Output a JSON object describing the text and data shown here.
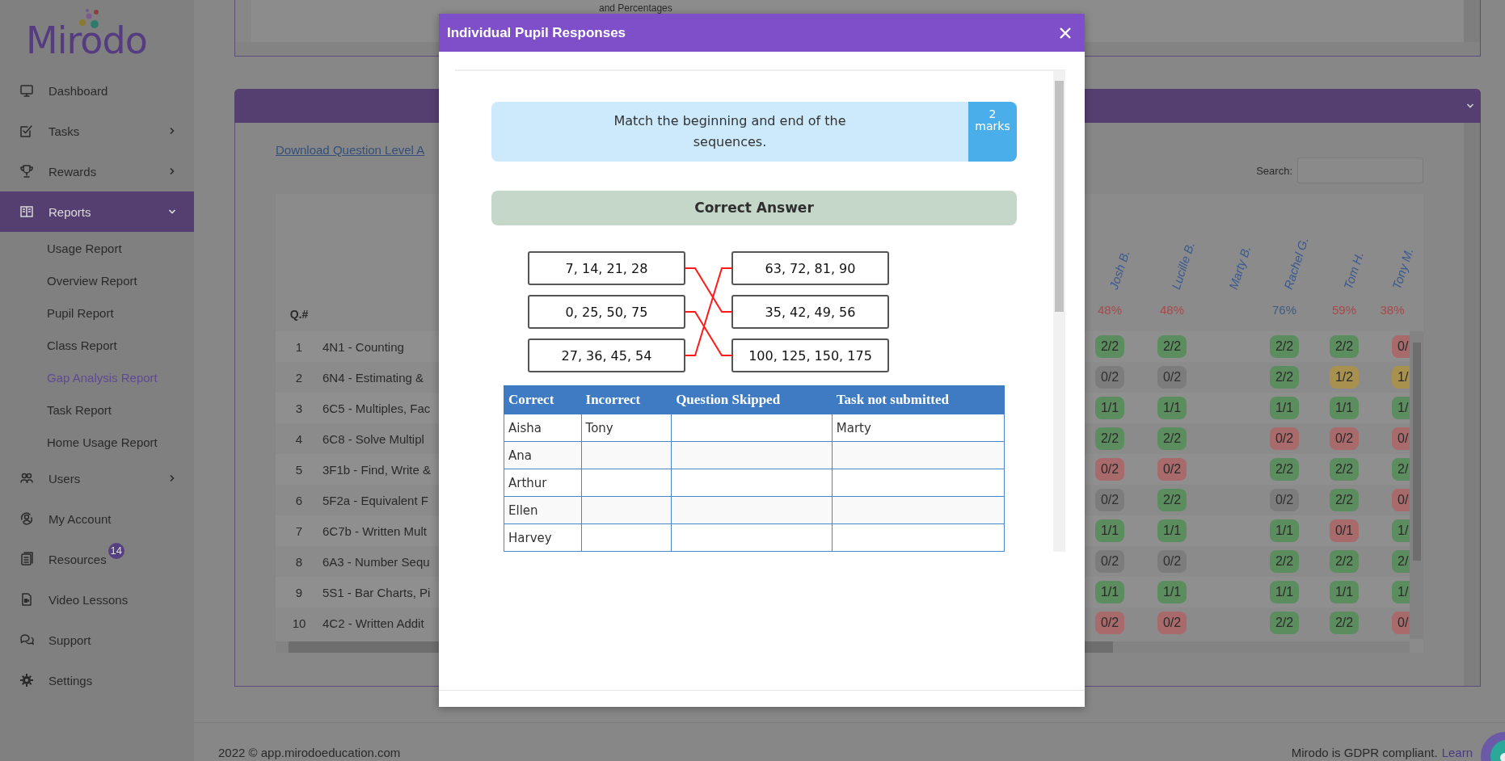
{
  "sidebar": {
    "logo": "Mirodo",
    "items": [
      {
        "label": "Dashboard",
        "selected": false
      },
      {
        "label": "Tasks",
        "selected": false,
        "expanded": false
      },
      {
        "label": "Rewards",
        "selected": false,
        "expanded": false
      },
      {
        "label": "Reports",
        "selected": true,
        "expanded": true,
        "children": [
          {
            "label": "Usage Report",
            "selected": false
          },
          {
            "label": "Overview Report",
            "selected": false
          },
          {
            "label": "Pupil Report",
            "selected": false
          },
          {
            "label": "Class Report",
            "selected": false
          },
          {
            "label": "Gap Analysis Report",
            "selected": true
          },
          {
            "label": "Task Report",
            "selected": false
          },
          {
            "label": "Home Usage Report",
            "selected": false
          }
        ]
      },
      {
        "label": "Users",
        "selected": false,
        "expanded": false
      },
      {
        "label": "My Account",
        "selected": false
      },
      {
        "label": "Resources",
        "selected": false,
        "badge": "14"
      },
      {
        "label": "Video Lessons",
        "selected": false
      },
      {
        "label": "Support",
        "selected": false
      },
      {
        "label": "Settings",
        "selected": false
      }
    ]
  },
  "top_card": {
    "text": "and Percentages"
  },
  "report": {
    "download_link": "Download Question Level A",
    "search": {
      "label": "Search:"
    },
    "question_header": "Q.#",
    "students": [
      {
        "name": "Josh B.",
        "percent": "48%",
        "color": "#a84a4a"
      },
      {
        "name": "Lucille B.",
        "percent": "48%",
        "color": "#a84a4a"
      },
      {
        "name": "Marty B."
      },
      {
        "name": "Rachel G.",
        "percent": "76%",
        "color": "#3e5c82"
      },
      {
        "name": "Tom H.",
        "percent": "59%",
        "color": "#a84a4a"
      },
      {
        "name": "Tony M.",
        "percent": "38%",
        "color": "#a84a4a"
      }
    ],
    "rows": [
      {
        "number": "1",
        "topic": "4N1 - Counting",
        "scores": [
          {
            "kind": "correct",
            "value": "2/2"
          },
          {
            "kind": "correct",
            "value": "2/2"
          },
          {
            "kind": "blank"
          },
          {
            "kind": "correct",
            "value": "2/2"
          },
          {
            "kind": "correct",
            "value": "2/2"
          },
          {
            "kind": "incorrect",
            "value": "0/"
          }
        ]
      },
      {
        "number": "2",
        "topic": "6N4 - Estimating &",
        "scores": [
          {
            "kind": "unanswered",
            "value": "0/2"
          },
          {
            "kind": "unanswered",
            "value": "0/2"
          },
          {
            "kind": "blank"
          },
          {
            "kind": "correct",
            "value": "2/2"
          },
          {
            "kind": "partial",
            "value": "1/2"
          },
          {
            "kind": "partial",
            "value": "1/"
          }
        ]
      },
      {
        "number": "3",
        "topic": "6C5 - Multiples, Fac",
        "scores": [
          {
            "kind": "correct",
            "value": "1/1"
          },
          {
            "kind": "correct",
            "value": "1/1"
          },
          {
            "kind": "blank"
          },
          {
            "kind": "correct",
            "value": "1/1"
          },
          {
            "kind": "correct",
            "value": "1/1"
          },
          {
            "kind": "correct",
            "value": "1/"
          }
        ]
      },
      {
        "number": "4",
        "topic": "6C8 - Solve Multipl",
        "scores": [
          {
            "kind": "correct",
            "value": "2/2"
          },
          {
            "kind": "correct",
            "value": "2/2"
          },
          {
            "kind": "blank"
          },
          {
            "kind": "incorrect",
            "value": "0/2"
          },
          {
            "kind": "incorrect",
            "value": "0/2"
          },
          {
            "kind": "incorrect",
            "value": "0/"
          }
        ]
      },
      {
        "number": "5",
        "topic": "3F1b - Find, Write &",
        "scores": [
          {
            "kind": "incorrect",
            "value": "0/2"
          },
          {
            "kind": "incorrect",
            "value": "0/2"
          },
          {
            "kind": "blank"
          },
          {
            "kind": "correct",
            "value": "2/2"
          },
          {
            "kind": "correct",
            "value": "2/2"
          },
          {
            "kind": "correct",
            "value": "2/"
          }
        ]
      },
      {
        "number": "6",
        "topic": "5F2a - Equivalent F",
        "scores": [
          {
            "kind": "unanswered",
            "value": "0/2"
          },
          {
            "kind": "correct",
            "value": "2/2"
          },
          {
            "kind": "blank"
          },
          {
            "kind": "unanswered",
            "value": "0/2"
          },
          {
            "kind": "correct",
            "value": "2/2"
          },
          {
            "kind": "incorrect",
            "value": "0/"
          }
        ]
      },
      {
        "number": "7",
        "topic": "6C7b - Written Mult",
        "scores": [
          {
            "kind": "correct",
            "value": "1/1"
          },
          {
            "kind": "correct",
            "value": "1/1"
          },
          {
            "kind": "blank"
          },
          {
            "kind": "correct",
            "value": "1/1"
          },
          {
            "kind": "incorrect",
            "value": "0/1"
          },
          {
            "kind": "correct",
            "value": "1/"
          }
        ]
      },
      {
        "number": "8",
        "topic": "6A3 - Number Sequ",
        "scores": [
          {
            "kind": "unanswered",
            "value": "0/2"
          },
          {
            "kind": "unanswered",
            "value": "0/2"
          },
          {
            "kind": "blank"
          },
          {
            "kind": "correct",
            "value": "2/2"
          },
          {
            "kind": "correct",
            "value": "2/2"
          },
          {
            "kind": "correct",
            "value": "2/"
          }
        ]
      },
      {
        "number": "9",
        "topic": "5S1 - Bar Charts, Pi",
        "scores": [
          {
            "kind": "correct",
            "value": "1/1"
          },
          {
            "kind": "correct",
            "value": "1/1"
          },
          {
            "kind": "blank"
          },
          {
            "kind": "correct",
            "value": "1/1"
          },
          {
            "kind": "correct",
            "value": "1/1"
          },
          {
            "kind": "correct",
            "value": "1/"
          }
        ]
      },
      {
        "number": "10",
        "topic": "4C2 - Written Addit",
        "scores": [
          {
            "kind": "incorrect",
            "value": "0/2"
          },
          {
            "kind": "incorrect",
            "value": "0/2"
          },
          {
            "kind": "blank"
          },
          {
            "kind": "correct",
            "value": "2/2"
          },
          {
            "kind": "correct",
            "value": "2/2"
          },
          {
            "kind": "incorrect",
            "value": "0/"
          }
        ]
      }
    ]
  },
  "modal": {
    "title": "Individual Pupil Responses",
    "question": {
      "text": "Match the beginning and end of the sequences.",
      "marks_value": "2",
      "marks_label": "marks"
    },
    "answer_heading": "Correct Answer",
    "matching": {
      "left": [
        "7, 14, 21, 28",
        "0, 25, 50, 75",
        "27, 36, 45, 54"
      ],
      "right": [
        "63, 72, 81, 90",
        "35, 42, 49, 56",
        "100, 125, 150, 175"
      ]
    },
    "responses": {
      "columns": [
        "Correct",
        "Incorrect",
        "Question Skipped",
        "Task not submitted"
      ],
      "rows": [
        [
          "Aisha",
          "Tony",
          null,
          "Marty"
        ],
        [
          "Ana"
        ],
        [
          "Arthur"
        ],
        [
          "Ellen"
        ],
        [
          "Harvey"
        ]
      ]
    }
  },
  "footer": {
    "copyright": "2022 © app.mirodoeducation.com",
    "gdpr": "Mirodo is GDPR compliant.",
    "learn_link": "Learn"
  }
}
